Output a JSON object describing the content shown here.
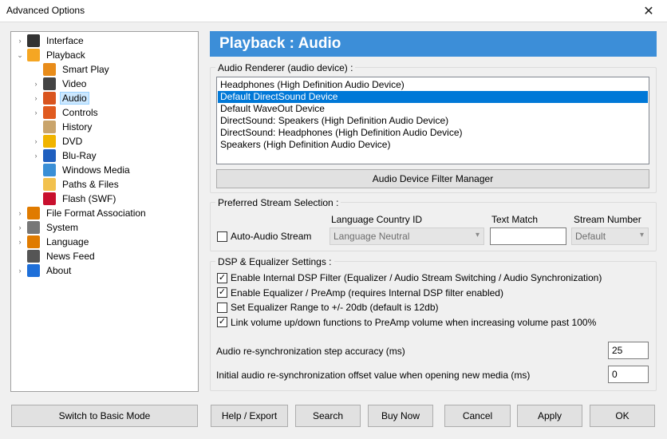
{
  "window": {
    "title": "Advanced Options",
    "close_glyph": "✕"
  },
  "tree": [
    {
      "label": "Interface",
      "icon": "interface-icon",
      "color": "#333333"
    },
    {
      "label": "Playback",
      "icon": "playback-icon",
      "color": "#f5a623"
    },
    {
      "label": "Smart Play",
      "icon": "smart-play-icon",
      "color": "#e88c1a"
    },
    {
      "label": "Video",
      "icon": "video-icon",
      "color": "#444444"
    },
    {
      "label": "Audio",
      "icon": "audio-icon",
      "color": "#d9541e"
    },
    {
      "label": "Controls",
      "icon": "controls-icon",
      "color": "#e05a1f"
    },
    {
      "label": "History",
      "icon": "history-icon",
      "color": "#c9a46b"
    },
    {
      "label": "DVD",
      "icon": "dvd-icon",
      "color": "#f0b400"
    },
    {
      "label": "Blu-Ray",
      "icon": "blu-ray-icon",
      "color": "#1f5fbf"
    },
    {
      "label": "Windows Media",
      "icon": "windows-media-icon",
      "color": "#3a8fd6"
    },
    {
      "label": "Paths & Files",
      "icon": "folder-icon",
      "color": "#f2c14e"
    },
    {
      "label": "Flash (SWF)",
      "icon": "flash-icon",
      "color": "#c8102e"
    },
    {
      "label": "File Format Association",
      "icon": "file-format-icon",
      "color": "#e07b00"
    },
    {
      "label": "System",
      "icon": "gear-icon",
      "color": "#777777"
    },
    {
      "label": "Language",
      "icon": "language-icon",
      "color": "#e07b00"
    },
    {
      "label": "News Feed",
      "icon": "news-icon",
      "color": "#555555"
    },
    {
      "label": "About",
      "icon": "info-icon",
      "color": "#1e6fd9"
    }
  ],
  "header": {
    "title": "Playback : Audio",
    "color": "#3c8ed8"
  },
  "renderer": {
    "legend": "Audio Renderer (audio device) :",
    "devices": [
      "Headphones (High Definition Audio Device)",
      "Default DirectSound Device",
      "Default WaveOut Device",
      "DirectSound: Speakers (High Definition Audio Device)",
      "DirectSound: Headphones (High Definition Audio Device)",
      "Speakers (High Definition Audio Device)"
    ],
    "selected_index": 1,
    "filter_button": "Audio Device Filter Manager"
  },
  "stream": {
    "legend": "Preferred Stream Selection :",
    "auto_audio_label": "Auto-Audio Stream",
    "auto_audio_checked": false,
    "language_label": "Language Country ID",
    "language_value": "Language Neutral",
    "text_match_label": "Text Match",
    "text_match_value": "",
    "stream_number_label": "Stream Number",
    "stream_number_value": "Default"
  },
  "dsp": {
    "legend": "DSP & Equalizer Settings :",
    "options": [
      {
        "label": "Enable Internal DSP Filter (Equalizer / Audio Stream Switching / Audio Synchronization)",
        "checked": true
      },
      {
        "label": "Enable Equalizer / PreAmp (requires Internal DSP filter enabled)",
        "checked": true
      },
      {
        "label": "Set Equalizer Range to +/- 20db (default is 12db)",
        "checked": false
      },
      {
        "label": "Link volume up/down functions to PreAmp volume when increasing volume past 100%",
        "checked": true
      }
    ],
    "resync_step_label": "Audio re-synchronization step accuracy (ms)",
    "resync_step_value": "25",
    "resync_offset_label": "Initial audio re-synchronization offset value when opening new media (ms)",
    "resync_offset_value": "0"
  },
  "footer": {
    "basic_mode": "Switch to Basic Mode",
    "help_export": "Help / Export",
    "search": "Search",
    "buy_now": "Buy Now",
    "cancel": "Cancel",
    "apply": "Apply",
    "ok": "OK"
  }
}
